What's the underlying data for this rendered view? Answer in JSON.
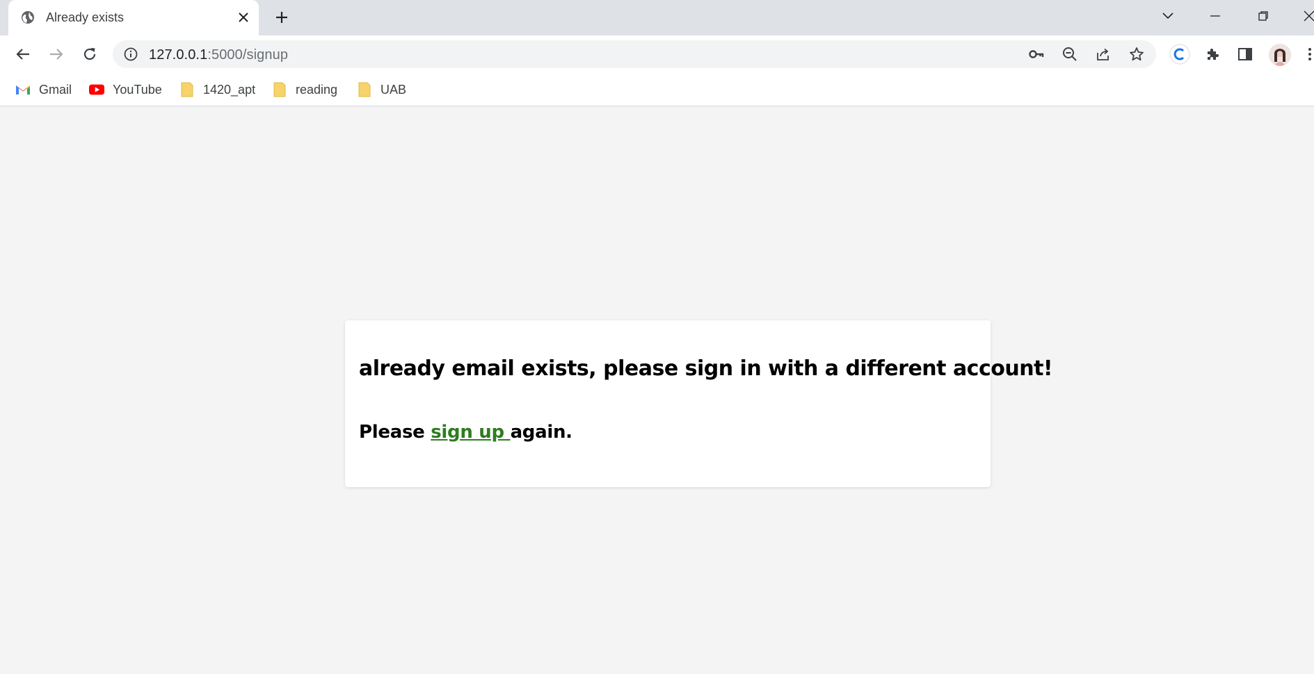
{
  "browser": {
    "tab": {
      "title": "Already exists"
    },
    "address_bar": {
      "host": "127.0.0.1",
      "path": ":5000/signup"
    },
    "bookmarks": [
      {
        "label": "Gmail",
        "icon": "gmail-icon"
      },
      {
        "label": "YouTube",
        "icon": "youtube-icon"
      },
      {
        "label": "1420_apt",
        "icon": "folder-icon"
      },
      {
        "label": "reading",
        "icon": "folder-icon"
      },
      {
        "label": "UAB",
        "icon": "folder-icon"
      }
    ]
  },
  "page": {
    "heading": "already email exists, please sign in with a different account!",
    "prompt_prefix": "Please ",
    "link_text": "sign up ",
    "prompt_suffix": "again."
  },
  "colors": {
    "link": "#2e7d1e",
    "page_background": "#f4f4f4",
    "card_background": "#ffffff"
  }
}
